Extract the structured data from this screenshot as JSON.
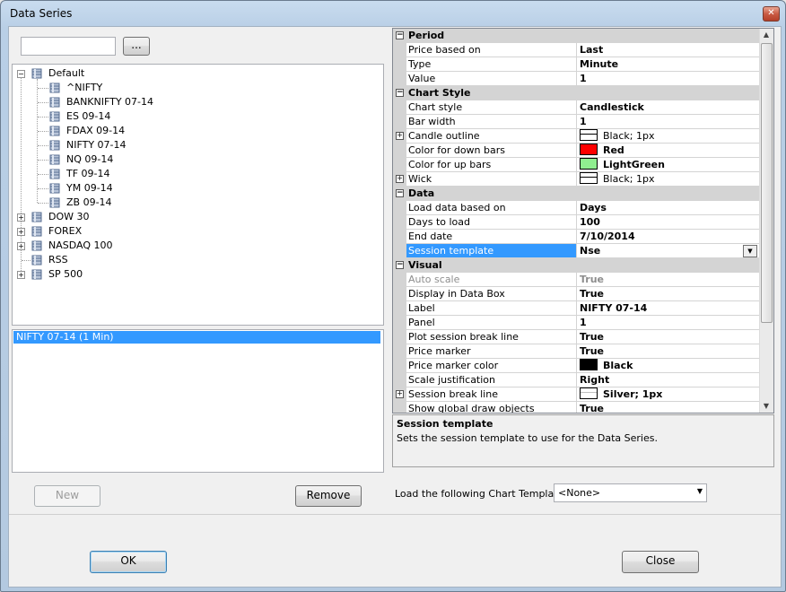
{
  "window": {
    "title": "Data Series",
    "close_glyph": "✕"
  },
  "search": {
    "value": "",
    "browse_label": "..."
  },
  "tree": {
    "default": {
      "label": "Default",
      "children": [
        "^NIFTY",
        "BANKNIFTY 07-14",
        "ES 09-14",
        "FDAX 09-14",
        "NIFTY 07-14",
        "NQ 09-14",
        "TF 09-14",
        "YM 09-14",
        "ZB 09-14"
      ]
    },
    "groups": [
      "DOW 30",
      "FOREX",
      "NASDAQ 100",
      "RSS",
      "SP 500"
    ]
  },
  "selected_series": {
    "items": [
      "NIFTY 07-14 (1 Min)"
    ]
  },
  "buttons": {
    "new": "New",
    "remove": "Remove",
    "ok": "OK",
    "close": "Close"
  },
  "properties": {
    "rows": [
      {
        "type": "cat",
        "name": "Period"
      },
      {
        "name": "Price based on",
        "value": "Last"
      },
      {
        "name": "Type",
        "value": "Minute"
      },
      {
        "name": "Value",
        "value": "1"
      },
      {
        "type": "cat",
        "name": "Chart Style"
      },
      {
        "name": "Chart style",
        "value": "Candlestick"
      },
      {
        "name": "Bar width",
        "value": "1"
      },
      {
        "name": "Candle outline",
        "value": "Black; 1px",
        "expand": true,
        "swatch": "line",
        "normal": true
      },
      {
        "name": "Color for down bars",
        "value": "Red",
        "swatch": "#ff0000"
      },
      {
        "name": "Color for up bars",
        "value": "LightGreen",
        "swatch": "#90ee90"
      },
      {
        "name": "Wick",
        "value": "Black; 1px",
        "expand": true,
        "swatch": "line",
        "normal": true
      },
      {
        "type": "cat",
        "name": "Data"
      },
      {
        "name": "Load data based on",
        "value": "Days"
      },
      {
        "name": "Days to load",
        "value": "100"
      },
      {
        "name": "End date",
        "value": "7/10/2014"
      },
      {
        "name": "Session template",
        "value": "Nse",
        "selected": true,
        "dropdown": true
      },
      {
        "type": "cat",
        "name": "Visual"
      },
      {
        "name": "Auto scale",
        "value": "True",
        "disabled": true
      },
      {
        "name": "Display in Data Box",
        "value": "True"
      },
      {
        "name": "Label",
        "value": "NIFTY 07-14"
      },
      {
        "name": "Panel",
        "value": "1"
      },
      {
        "name": "Plot session break line",
        "value": "True"
      },
      {
        "name": "Price marker",
        "value": "True"
      },
      {
        "name": "Price marker color",
        "value": "Black",
        "swatch": "#000000"
      },
      {
        "name": "Scale justification",
        "value": "Right"
      },
      {
        "name": "Session break line",
        "value": "Silver;  1px",
        "expand": true,
        "swatch": "line"
      },
      {
        "name": "Show global draw objects",
        "value": "True"
      }
    ]
  },
  "description": {
    "title": "Session template",
    "text": "Sets the session template to use for the Data Series."
  },
  "chart_template": {
    "label": "Load the following Chart Template:",
    "value": "<None>"
  }
}
